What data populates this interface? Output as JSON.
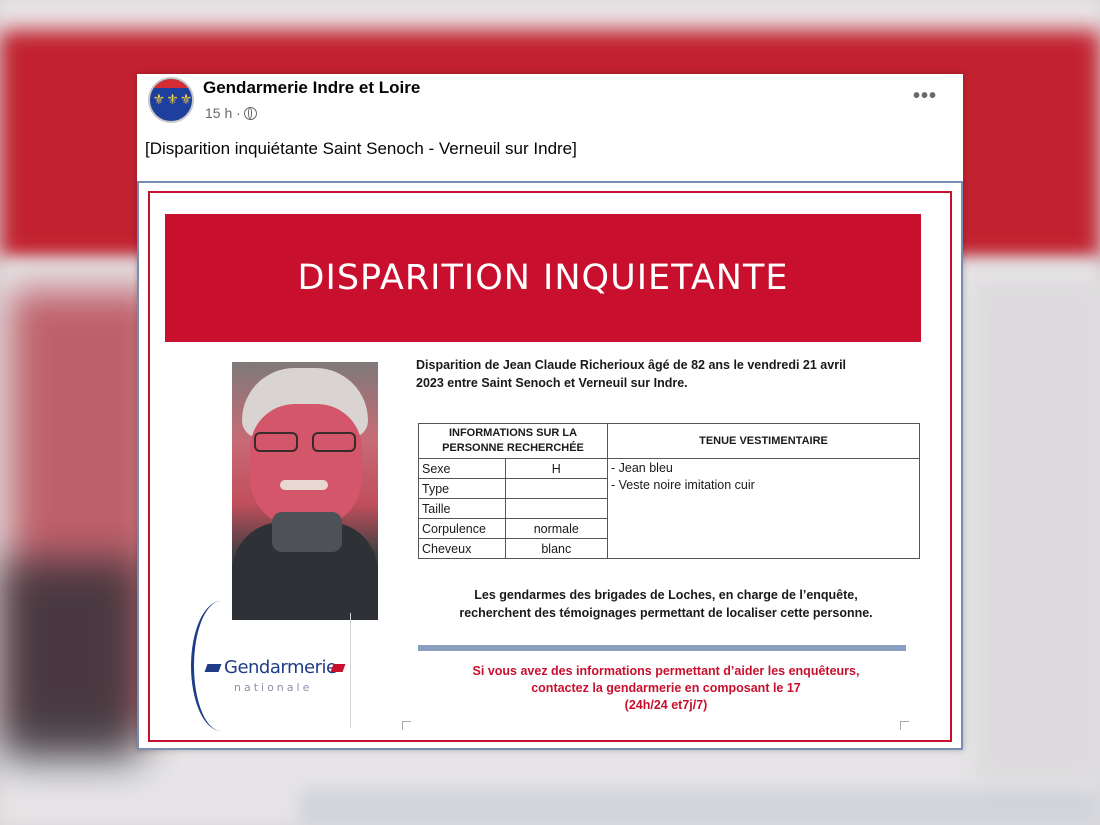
{
  "post": {
    "page_name": "Gendarmerie Indre et Loire",
    "time": "15 h ·",
    "more": "•••",
    "text": "[Disparition inquiétante Saint Senoch - Verneuil sur Indre]",
    "avatar_glyphs": "⚜⚜⚜"
  },
  "poster": {
    "banner": "DISPARITION INQUIETANTE",
    "description_line1": "Disparition de Jean Claude Richerioux âgé de 82 ans le vendredi 21 avril",
    "description_line2": "2023 entre Saint Senoch et Verneuil sur Indre.",
    "table": {
      "header_info_line1": "INFORMATIONS SUR LA",
      "header_info_line2": "PERSONNE RECHERCHÉE",
      "header_tenue": "TENUE VESTIMENTAIRE",
      "rows": [
        {
          "label": "Sexe",
          "value": "H"
        },
        {
          "label": "Type",
          "value": ""
        },
        {
          "label": "Taille",
          "value": ""
        },
        {
          "label": "Corpulence",
          "value": "normale"
        },
        {
          "label": "Cheveux",
          "value": "blanc"
        }
      ],
      "tenue_line1": "- Jean bleu",
      "tenue_line2": "- Veste noire imitation cuir"
    },
    "gendarmes_line1": "Les gendarmes des brigades de Loches, en charge de l’enquête,",
    "gendarmes_line2": "recherchent des témoignages permettant de localiser cette personne.",
    "appeal_line1": "Si vous avez des informations permettant d’aider les enquêteurs,",
    "appeal_line2": "contactez la gendarmerie en composant le 17",
    "appeal_line3": "(24h/24 et7j/7)",
    "logo_name": "Gendarmerie",
    "logo_sub": "nationale"
  },
  "colors": {
    "accent_red": "#c8102e",
    "logo_blue": "#1f3c88"
  }
}
